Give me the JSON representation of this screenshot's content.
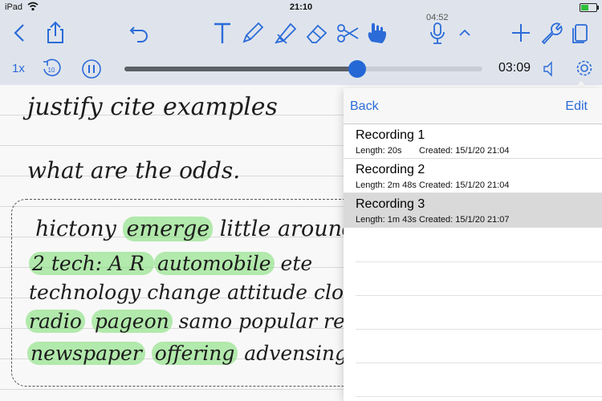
{
  "status": {
    "device": "iPad",
    "time": "21:10"
  },
  "toolbar": {
    "mini_time": "04:52"
  },
  "playback": {
    "speed": "1x",
    "elapsed": "03:09",
    "progress": 0.65
  },
  "note": {
    "line1": "justify cite examples",
    "line2": "what are the odds.",
    "line3a": "hictony ",
    "line3b": "emerge",
    "line3c": " little around",
    "line4a": "2 tech: A R ",
    "line4b": "automobile",
    "line4c": " ete",
    "line5": "technology change attitude close spe",
    "line6a": "radio",
    "line6b": "pageon",
    "line6c": " samo popular repea",
    "line7a": "newspaper",
    "line7b": "offering",
    "line7c": " advensing int"
  },
  "popover": {
    "back": "Back",
    "edit": "Edit",
    "recordings": [
      {
        "title": "Recording 1",
        "length": "Length: 20s",
        "created": "Created: 15/1/20 21:04"
      },
      {
        "title": "Recording 2",
        "length": "Length: 2m 48s",
        "created": "Created: 15/1/20 21:04"
      },
      {
        "title": "Recording 3",
        "length": "Length: 1m 43s",
        "created": "Created: 15/1/20 21:07"
      }
    ]
  },
  "colors": {
    "accent": "#2a6bd8",
    "highlight": "#86dc74",
    "selected_row": "#d9d9d9"
  },
  "icons": [
    "back-chevron-icon",
    "share-icon",
    "undo-icon",
    "text-tool-icon",
    "pen-icon",
    "highlighter-icon",
    "eraser-icon",
    "scissors-icon",
    "hand-icon",
    "microphone-icon",
    "chevron-up-icon",
    "add-icon",
    "wrench-icon",
    "pages-icon",
    "rewind-10-icon",
    "pause-icon",
    "speaker-icon",
    "gear-icon"
  ]
}
